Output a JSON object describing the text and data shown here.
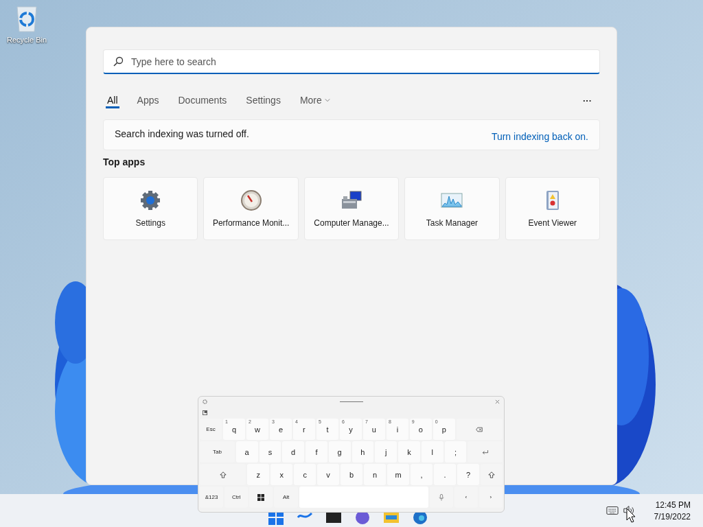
{
  "desktop": {
    "icons": [
      {
        "label": "Recycle Bin"
      }
    ]
  },
  "search": {
    "placeholder": "Type here to search",
    "tabs": [
      {
        "label": "All",
        "selected": true
      },
      {
        "label": "Apps",
        "selected": false
      },
      {
        "label": "Documents",
        "selected": false
      },
      {
        "label": "Settings",
        "selected": false
      },
      {
        "label": "More",
        "selected": false,
        "dropdown": true
      }
    ],
    "more_button": "···",
    "notice": {
      "text": "Search indexing was turned off.",
      "link": "Turn indexing back on."
    },
    "section_title": "Top apps",
    "apps": [
      {
        "label": "Settings"
      },
      {
        "label": "Performance Monit..."
      },
      {
        "label": "Computer Manage..."
      },
      {
        "label": "Task Manager"
      },
      {
        "label": "Event Viewer"
      }
    ]
  },
  "keyboard": {
    "rows": [
      [
        {
          "kind": "fn",
          "label": "Esc"
        },
        {
          "kind": "letter",
          "label": "q",
          "alt": "1"
        },
        {
          "kind": "letter",
          "label": "w",
          "alt": "2"
        },
        {
          "kind": "letter",
          "label": "e",
          "alt": "3"
        },
        {
          "kind": "letter",
          "label": "r",
          "alt": "4"
        },
        {
          "kind": "letter",
          "label": "t",
          "alt": "5"
        },
        {
          "kind": "letter",
          "label": "y",
          "alt": "6"
        },
        {
          "kind": "letter",
          "label": "u",
          "alt": "7"
        },
        {
          "kind": "letter",
          "label": "i",
          "alt": "8"
        },
        {
          "kind": "letter",
          "label": "o",
          "alt": "9"
        },
        {
          "kind": "letter",
          "label": "p",
          "alt": "0"
        },
        {
          "kind": "backspace"
        }
      ],
      [
        {
          "kind": "fn",
          "label": "Tab"
        },
        {
          "kind": "letter",
          "label": "a"
        },
        {
          "kind": "letter",
          "label": "s"
        },
        {
          "kind": "letter",
          "label": "d"
        },
        {
          "kind": "letter",
          "label": "f"
        },
        {
          "kind": "letter",
          "label": "g"
        },
        {
          "kind": "letter",
          "label": "h"
        },
        {
          "kind": "letter",
          "label": "j"
        },
        {
          "kind": "letter",
          "label": "k"
        },
        {
          "kind": "letter",
          "label": "l"
        },
        {
          "kind": "letter",
          "label": ";"
        },
        {
          "kind": "enter"
        }
      ],
      [
        {
          "kind": "shift"
        },
        {
          "kind": "letter",
          "label": "z"
        },
        {
          "kind": "letter",
          "label": "x"
        },
        {
          "kind": "letter",
          "label": "c"
        },
        {
          "kind": "letter",
          "label": "v"
        },
        {
          "kind": "letter",
          "label": "b"
        },
        {
          "kind": "letter",
          "label": "n"
        },
        {
          "kind": "letter",
          "label": "m"
        },
        {
          "kind": "letter",
          "label": ","
        },
        {
          "kind": "letter",
          "label": "."
        },
        {
          "kind": "letter",
          "label": "?"
        },
        {
          "kind": "shift"
        }
      ],
      [
        {
          "kind": "fn",
          "label": "&123"
        },
        {
          "kind": "fn",
          "label": "Ctrl"
        },
        {
          "kind": "windows"
        },
        {
          "kind": "fn",
          "label": "Alt"
        },
        {
          "kind": "space"
        },
        {
          "kind": "mic"
        },
        {
          "kind": "fn",
          "label": "‹"
        },
        {
          "kind": "fn",
          "label": "›"
        }
      ]
    ]
  },
  "taskbar": {
    "time": "12:45 PM",
    "date": "7/19/2022"
  }
}
